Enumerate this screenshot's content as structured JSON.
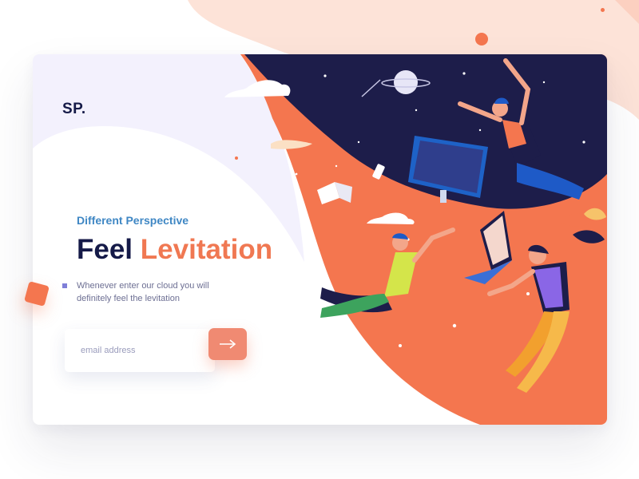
{
  "brand": {
    "logo_text": "SP."
  },
  "hero": {
    "subtitle": "Different Perspective",
    "headline_primary": "Feel",
    "headline_accent": "Levitation",
    "description": "Whenever enter our cloud you will\ndefinitely feel  the levitation"
  },
  "signup": {
    "email_placeholder": "email address",
    "submit_icon": "arrow-right-icon"
  },
  "colors": {
    "navy": "#151a48",
    "accent": "#f07852",
    "subtitle_blue": "#3f87c4",
    "space": "#1d1d4a",
    "peach": "#fde1d6",
    "button": "#f08a72"
  }
}
